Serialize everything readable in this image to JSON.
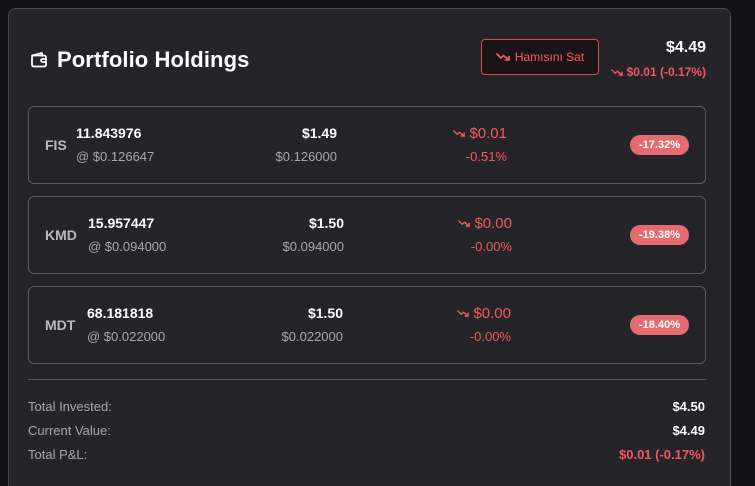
{
  "header": {
    "title": "Portfolio Holdings",
    "sell_all_label": "Hamısını Sat",
    "total_value": "$4.49",
    "total_change": "$0.01 (-0.17%)"
  },
  "holdings": [
    {
      "symbol": "FIS",
      "quantity": "11.843976",
      "avg_price": "@ $0.126647",
      "value": "$1.49",
      "current_price": "$0.126000",
      "pnl": "$0.01",
      "pnl_percent": "-0.51%",
      "badge": "-17.32%"
    },
    {
      "symbol": "KMD",
      "quantity": "15.957447",
      "avg_price": "@ $0.094000",
      "value": "$1.50",
      "current_price": "$0.094000",
      "pnl": "$0.00",
      "pnl_percent": "-0.00%",
      "badge": "-19.38%"
    },
    {
      "symbol": "MDT",
      "quantity": "68.181818",
      "avg_price": "@ $0.022000",
      "value": "$1.50",
      "current_price": "$0.022000",
      "pnl": "$0.00",
      "pnl_percent": "-0.00%",
      "badge": "-18.40%"
    }
  ],
  "summary": {
    "total_invested_label": "Total Invested:",
    "total_invested_value": "$4.50",
    "current_value_label": "Current Value:",
    "current_value_value": "$4.49",
    "total_pnl_label": "Total P&L:",
    "total_pnl_value": "$0.01 (-0.17%)"
  },
  "colors": {
    "background": "#252529",
    "negative": "#f05a5f",
    "badge": "#e46b6e"
  },
  "icons": {
    "title_icon": "wallet-icon",
    "trend_icon": "trending-down-icon"
  }
}
